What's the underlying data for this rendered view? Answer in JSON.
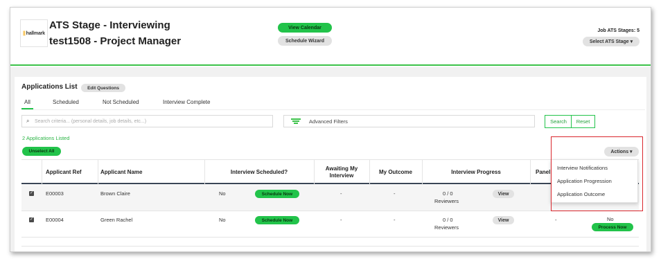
{
  "header": {
    "logo_text": "hallmark",
    "title_line1": "ATS Stage - Interviewing",
    "title_line2": "test1508 - Project Manager",
    "view_calendar_label": "View Calendar",
    "schedule_wizard_label": "Schedule Wizard",
    "ats_stages_label": "Job ATS Stages: 5",
    "select_ats_stage_label": "Select ATS Stage ▾"
  },
  "applications": {
    "title": "Applications List",
    "edit_questions_label": "Edit Questions",
    "tabs": [
      {
        "label": "All",
        "active": true
      },
      {
        "label": "Scheduled",
        "active": false
      },
      {
        "label": "Not Scheduled",
        "active": false
      },
      {
        "label": "Interview Complete",
        "active": false
      }
    ],
    "search_placeholder": "Search criteria... (personal details, job details, etc...)",
    "advanced_filters_label": "Advanced Filters",
    "search_button": "Search",
    "reset_button": "Reset",
    "count_text": "2 Applications Listed",
    "unselect_all_label": "Unselect All",
    "actions_label": "Actions ▾",
    "accent_color": "#22c34a"
  },
  "table": {
    "headers": {
      "ref": "Applicant Ref",
      "name": "Applicant Name",
      "scheduled": "Interview Scheduled?",
      "awaiting_1": "Awaiting My",
      "awaiting_2": "Interview",
      "outcome": "My Outcome",
      "progress": "Interview Progress",
      "panel": "Panel"
    },
    "rows": [
      {
        "checked": true,
        "ref": "E00003",
        "name": "Brown Claire",
        "scheduled": "No",
        "schedule_now": "Schedule Now",
        "awaiting": "-",
        "outcome": "-",
        "progress": "0 / 0",
        "reviewers": "Reviewers",
        "view": "View",
        "panel": "",
        "last": "",
        "process_now": ""
      },
      {
        "checked": true,
        "ref": "E00004",
        "name": "Green Rachel",
        "scheduled": "No",
        "schedule_now": "Schedule Now",
        "awaiting": "-",
        "outcome": "-",
        "progress": "0 / 0",
        "reviewers": "Reviewers",
        "view": "View",
        "panel": "-",
        "last": "No",
        "process_now": "Process Now"
      }
    ]
  },
  "actions_menu": {
    "items": [
      "Interview Notifications",
      "Application Progression",
      "Application Outcome"
    ]
  }
}
